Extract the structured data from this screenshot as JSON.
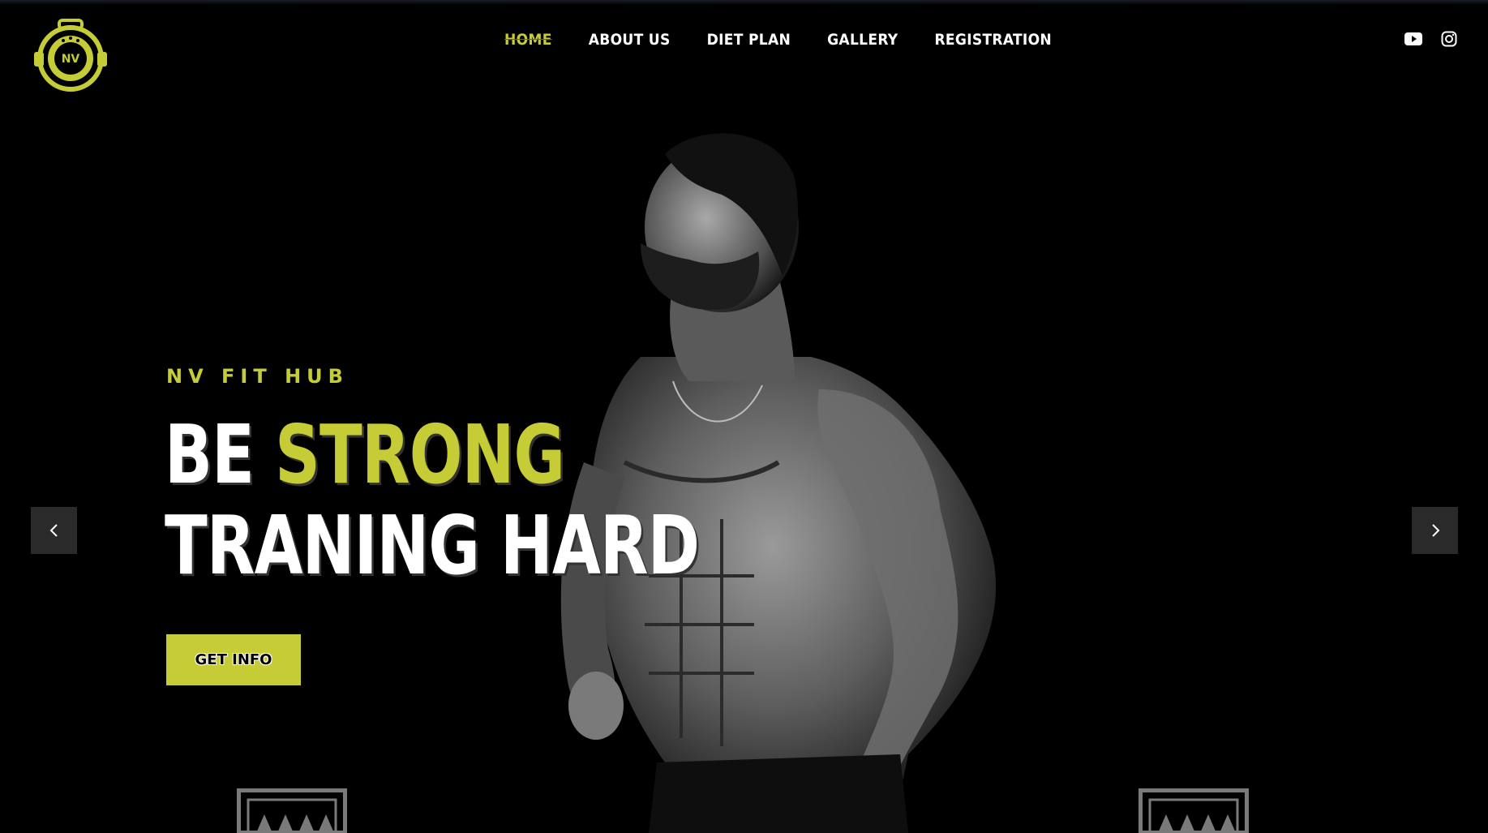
{
  "brand": {
    "logo_icon": "kettlebell-badge-logo",
    "logo_text": "NV",
    "accent_color": "#c5cc35"
  },
  "nav": {
    "items": [
      {
        "label": "HOME",
        "active": true
      },
      {
        "label": "ABOUT US",
        "active": false
      },
      {
        "label": "DIET PLAN",
        "active": false
      },
      {
        "label": "GALLERY",
        "active": false
      },
      {
        "label": "REGISTRATION",
        "active": false
      }
    ]
  },
  "social": {
    "icons": [
      "youtube-icon",
      "instagram-icon"
    ]
  },
  "hero": {
    "subtitle": "NV FIT HUB",
    "headline_word1": "BE",
    "headline_word2": "STRONG",
    "headline_line2": "TRANING HARD",
    "cta_label": "GET INFO"
  },
  "carousel": {
    "prev_icon": "chevron-left-icon",
    "next_icon": "chevron-right-icon"
  }
}
